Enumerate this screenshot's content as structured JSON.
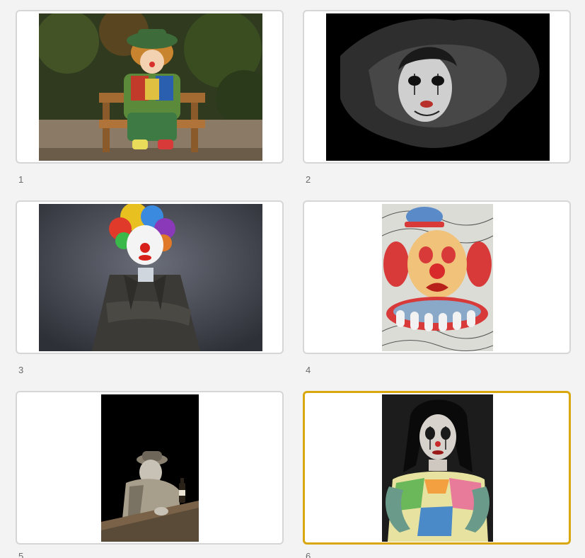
{
  "slides": [
    {
      "number": "1",
      "image": "doll-clown-on-bench-image"
    },
    {
      "number": "2",
      "image": "dark-clown-face-image"
    },
    {
      "number": "3",
      "image": "clown-rainbow-wig-image"
    },
    {
      "number": "4",
      "image": "clown-drawing-image"
    },
    {
      "number": "5",
      "image": "clown-bar-illustration-image"
    },
    {
      "number": "6",
      "image": "clown-woman-portrait-image"
    }
  ],
  "selected_slide": "6",
  "colors": {
    "selected_border": "#d9a710",
    "card_border": "#d6d6d6",
    "background": "#f3f3f3"
  }
}
